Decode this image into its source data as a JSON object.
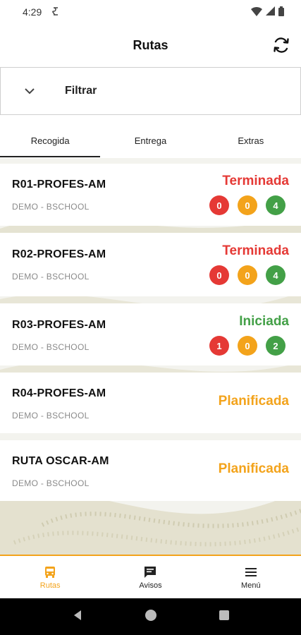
{
  "status_bar": {
    "time": "4:29"
  },
  "header": {
    "title": "Rutas"
  },
  "filter": {
    "label": "Filtrar"
  },
  "tabs": [
    {
      "label": "Recogida",
      "active": true
    },
    {
      "label": "Entrega",
      "active": false
    },
    {
      "label": "Extras",
      "active": false
    }
  ],
  "routes": [
    {
      "name": "R01-PROFES-AM",
      "school": "DEMO - BSCHOOL",
      "status": "Terminada",
      "status_color": "#e53935",
      "counts": [
        "0",
        "0",
        "4"
      ]
    },
    {
      "name": "R02-PROFES-AM",
      "school": "DEMO - BSCHOOL",
      "status": "Terminada",
      "status_color": "#e53935",
      "counts": [
        "0",
        "0",
        "4"
      ]
    },
    {
      "name": "R03-PROFES-AM",
      "school": "DEMO - BSCHOOL",
      "status": "Iniciada",
      "status_color": "#43a047",
      "counts": [
        "1",
        "0",
        "2"
      ]
    },
    {
      "name": "R04-PROFES-AM",
      "school": "DEMO - BSCHOOL",
      "status": "Planificada",
      "status_color": "#f3a31b",
      "counts": []
    },
    {
      "name": "RUTA OSCAR-AM",
      "school": "DEMO - BSCHOOL",
      "status": "Planificada",
      "status_color": "#f3a31b",
      "counts": []
    }
  ],
  "badge_colors": [
    "#e53935",
    "#f3a31b",
    "#43a047"
  ],
  "bottom_nav": [
    {
      "label": "Rutas",
      "icon": "bus-icon",
      "active": true
    },
    {
      "label": "Avisos",
      "icon": "chat-icon",
      "active": false
    },
    {
      "label": "Menú",
      "icon": "menu-icon",
      "active": false
    }
  ],
  "colors": {
    "accent": "#f3a31b"
  }
}
